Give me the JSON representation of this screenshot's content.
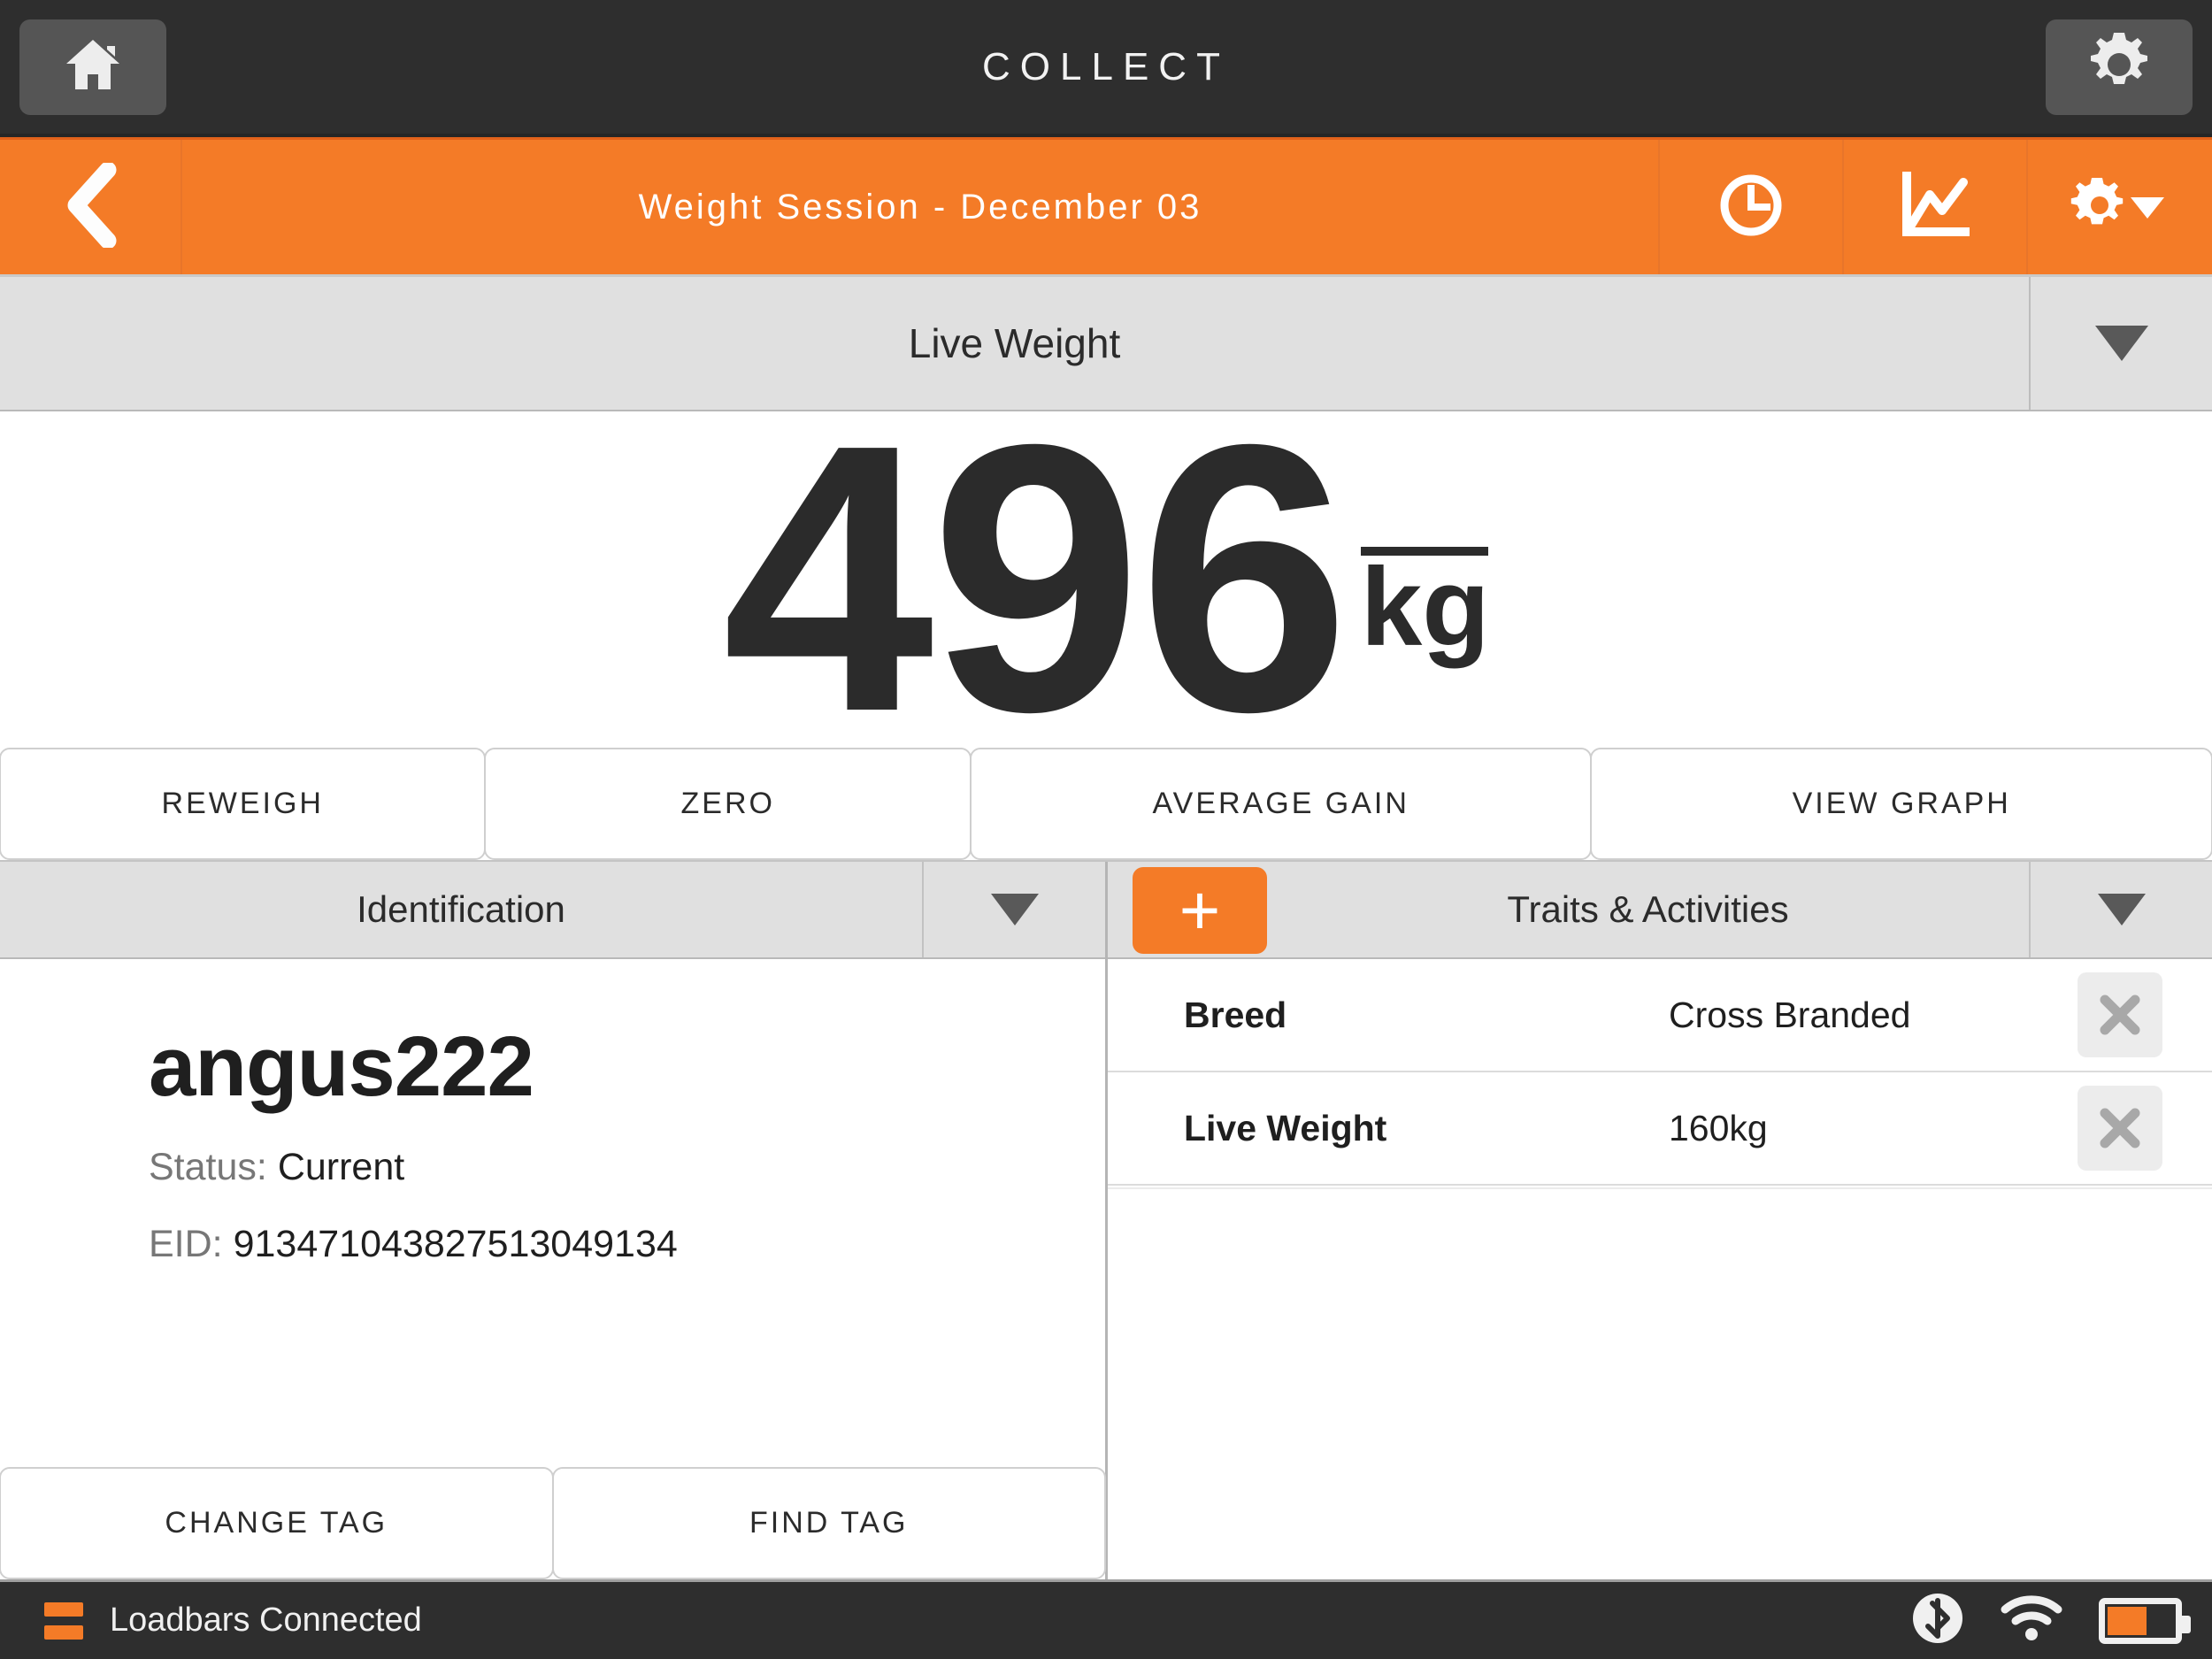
{
  "topbar": {
    "title": "COLLECT",
    "home_icon": "home-icon",
    "settings_icon": "gear-icon",
    "bg_color": "#2e2e2e"
  },
  "session_bar": {
    "back_icon": "chevron-left-icon",
    "title": "Weight Session - December 03",
    "accent_color": "#f47b27",
    "icons": [
      {
        "name": "clock-icon",
        "label": "Session history"
      },
      {
        "name": "line-chart-icon",
        "label": "Session graph"
      },
      {
        "name": "gear-dropdown-icon",
        "label": "Session settings"
      }
    ]
  },
  "live_weight": {
    "header_label": "Live Weight",
    "value": "496",
    "unit": "kg",
    "header_caret": "chevron-down-icon"
  },
  "actions": [
    {
      "label": "REWEIGH",
      "name": "reweigh-button"
    },
    {
      "label": "ZERO",
      "name": "zero-button"
    },
    {
      "label": "AVERAGE GAIN",
      "name": "average-gain-button"
    },
    {
      "label": "VIEW GRAPH",
      "name": "view-graph-button"
    }
  ],
  "identification": {
    "header_label": "Identification",
    "header_caret": "chevron-down-icon",
    "animal_name": "angus222",
    "status_label": "Status:",
    "status_value": "Current",
    "eid_label": "EID:",
    "eid_value": "913471043827513049134",
    "buttons": [
      {
        "label": "CHANGE TAG",
        "name": "change-tag-button"
      },
      {
        "label": "FIND TAG",
        "name": "find-tag-button"
      }
    ]
  },
  "traits": {
    "header_label": "Traits & Activities",
    "header_caret": "chevron-down-icon",
    "add_label": "+",
    "rows": [
      {
        "name": "Breed",
        "value": "Cross Branded",
        "remove_icon": "close-icon"
      },
      {
        "name": "Live Weight",
        "value": "160kg",
        "remove_icon": "close-icon"
      }
    ]
  },
  "statusbar": {
    "loadbars_icon": "loadbars-icon",
    "text": "Loadbars Connected",
    "bluetooth_icon": "bluetooth-icon",
    "wifi_icon": "wifi-icon",
    "battery_icon": "battery-icon",
    "battery_percent": 60,
    "accent_color": "#f47b27"
  }
}
